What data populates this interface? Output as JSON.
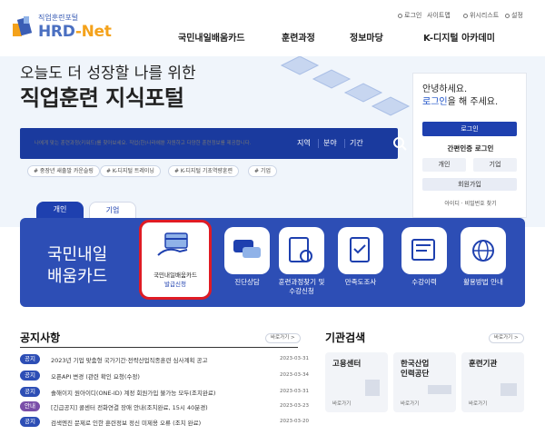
{
  "header": {
    "logo_sub": "직업훈련포털",
    "logo_hrd": "HRD",
    "logo_net": "-Net",
    "util": [
      "로그인",
      "사이트맵",
      "위시리스트",
      "설정"
    ],
    "gnb": [
      "국민내일배움카드",
      "훈련과정",
      "정보마당",
      "K-디지털 아카데미"
    ]
  },
  "hero": {
    "line1": "오늘도 더 성장할 나를 위한",
    "line2": "직업훈련 지식포털",
    "search_placeholder": "나에게 맞는 훈련과정(키워드)를 찾아보세요. 직업(한)나라에뿐 자원하고 다양한 훈련정보를 제공합니다.",
    "search_opts": [
      "지역",
      "분야",
      "기간"
    ],
    "tags": [
      "# 중장년 새출발 카운슬링",
      "# K-디지털 트레이닝",
      "# K-디지털 기초역량훈련",
      "# 기업"
    ]
  },
  "login": {
    "hi": "안녕하세요.",
    "login_link": "로그인",
    "hi_rest": "을 해 주세요.",
    "login_btn": "로그인",
    "cert": "간편인증 로그인",
    "personal": "개인",
    "company": "기업",
    "join": "회원가입",
    "find": "아이디 · 비밀번호 찾기"
  },
  "tabs": {
    "personal": "개인",
    "company": "기업"
  },
  "band": {
    "title1": "국민내일",
    "title2": "배움카드",
    "card_lbl1": "국민내일배움카드",
    "card_lbl2": "발급신청",
    "services": [
      {
        "label": "진단상담"
      },
      {
        "label": "훈련과정찾기 및\n수강신청"
      },
      {
        "label": "만족도조사"
      },
      {
        "label": "수강이력"
      },
      {
        "label": "활용방법 안내"
      }
    ]
  },
  "notice": {
    "title": "공지사항",
    "more": "바로가기 >",
    "items": [
      {
        "badge": "공지",
        "text": "2023년 기업 맞춤형 국가기간·전략산업직종훈련 심사계획 공고",
        "date": "2023-03-31"
      },
      {
        "badge": "공지",
        "text": "오픈API 변경 (관련 확인 요청(수정)",
        "date": "2023-03-34"
      },
      {
        "badge": "공지",
        "text": "솔해이지 원아이디(ONE-ID) 계정 회원가입 불가능 모두(조치완료)",
        "date": "2023-03-31"
      },
      {
        "badge": "안내",
        "text": "[긴급공지] 콜센터 전화연결 장애 안내(조치완료, 15시 40분경)",
        "date": "2023-03-23"
      },
      {
        "badge": "공지",
        "text": "검색엔진 문제로 인한 훈련정보 정신 미제용 오류 (조치 완료)",
        "date": "2023-03-20"
      }
    ]
  },
  "orgs": {
    "title": "기관검색",
    "more": "바로가기 >",
    "items": [
      {
        "name": "고용센터",
        "go": "바로가기"
      },
      {
        "name": "한국산업\n인력공단",
        "go": "바로가기"
      },
      {
        "name": "훈련기관",
        "go": "바로가기"
      }
    ]
  }
}
